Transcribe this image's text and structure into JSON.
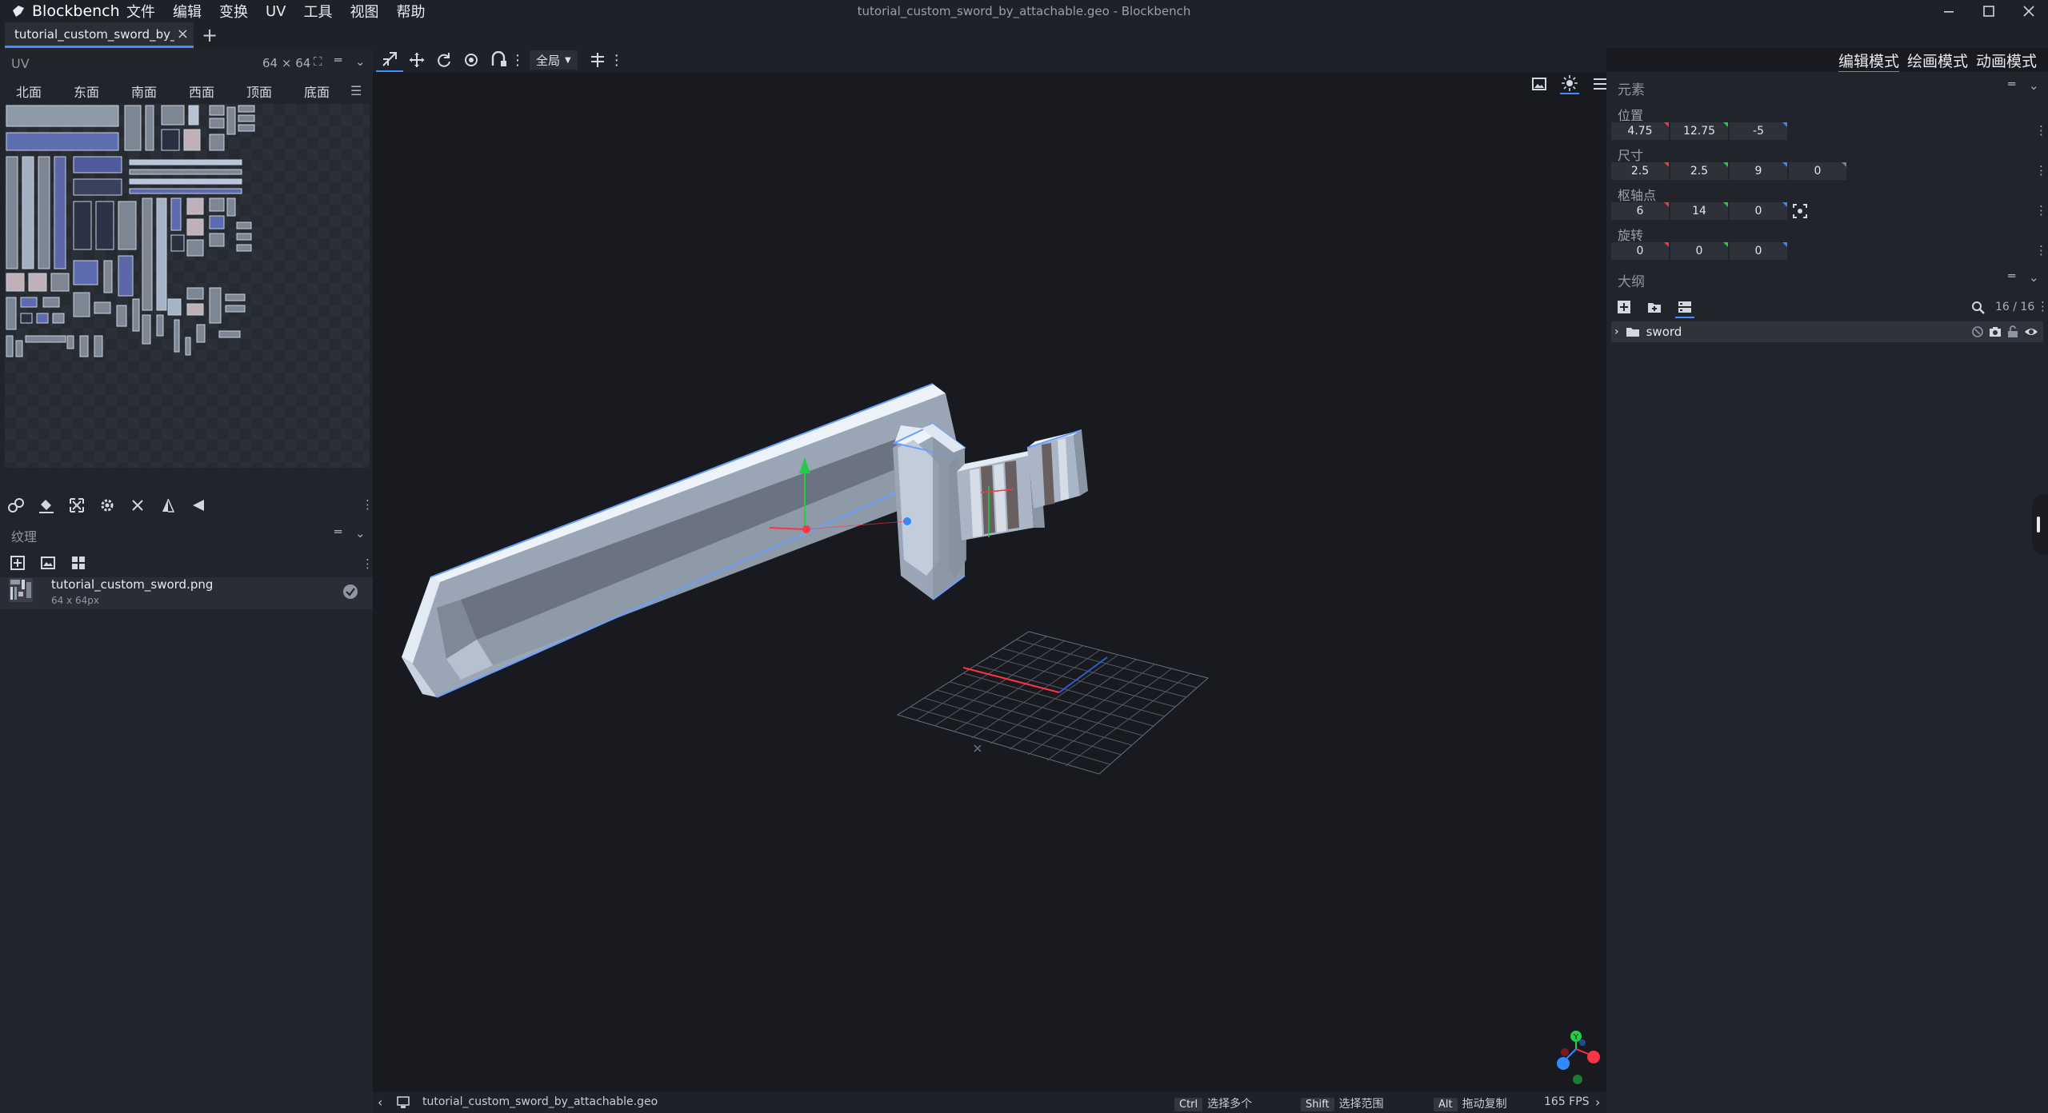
{
  "app": {
    "name": "Blockbench",
    "window_title": "tutorial_custom_sword_by_attachable.geo - Blockbench"
  },
  "menu": [
    "文件",
    "编辑",
    "变换",
    "UV",
    "工具",
    "视图",
    "帮助"
  ],
  "tab": {
    "label": "tutorial_custom_sword_by_attachable.geo"
  },
  "uv_panel": {
    "title": "UV",
    "size": "64 × 64",
    "faces": [
      "北面",
      "东面",
      "南面",
      "西面",
      "顶面",
      "底面"
    ]
  },
  "texture_panel": {
    "title": "纹理",
    "texture_name": "tutorial_custom_sword.png",
    "texture_size": "64 x 64px"
  },
  "toolbar": {
    "space": "全局"
  },
  "modes": [
    "编辑模式",
    "绘画模式",
    "动画模式"
  ],
  "element_panel": {
    "title": "元素",
    "position": {
      "label": "位置",
      "values": [
        "4.75",
        "12.75",
        "-5"
      ]
    },
    "size": {
      "label": "尺寸",
      "values": [
        "2.5",
        "2.5",
        "9",
        "0"
      ]
    },
    "pivot": {
      "label": "枢轴点",
      "values": [
        "6",
        "14",
        "0"
      ]
    },
    "rotation": {
      "label": "旋转",
      "values": [
        "0",
        "0",
        "0"
      ]
    }
  },
  "outliner": {
    "title": "大纲",
    "count": "16 / 16",
    "group": "sword"
  },
  "statusbar": {
    "file": "tutorial_custom_sword_by_attachable.geo",
    "hints": [
      {
        "key": "Ctrl",
        "text": "选择多个"
      },
      {
        "key": "Shift",
        "text": "选择范围"
      },
      {
        "key": "Alt",
        "text": "拖动复制"
      }
    ],
    "fps": "165 FPS"
  },
  "colors": {
    "accent": "#3e90ff",
    "axis_x": "#ff3344",
    "axis_y": "#22cc44",
    "axis_z": "#2f8bff"
  }
}
